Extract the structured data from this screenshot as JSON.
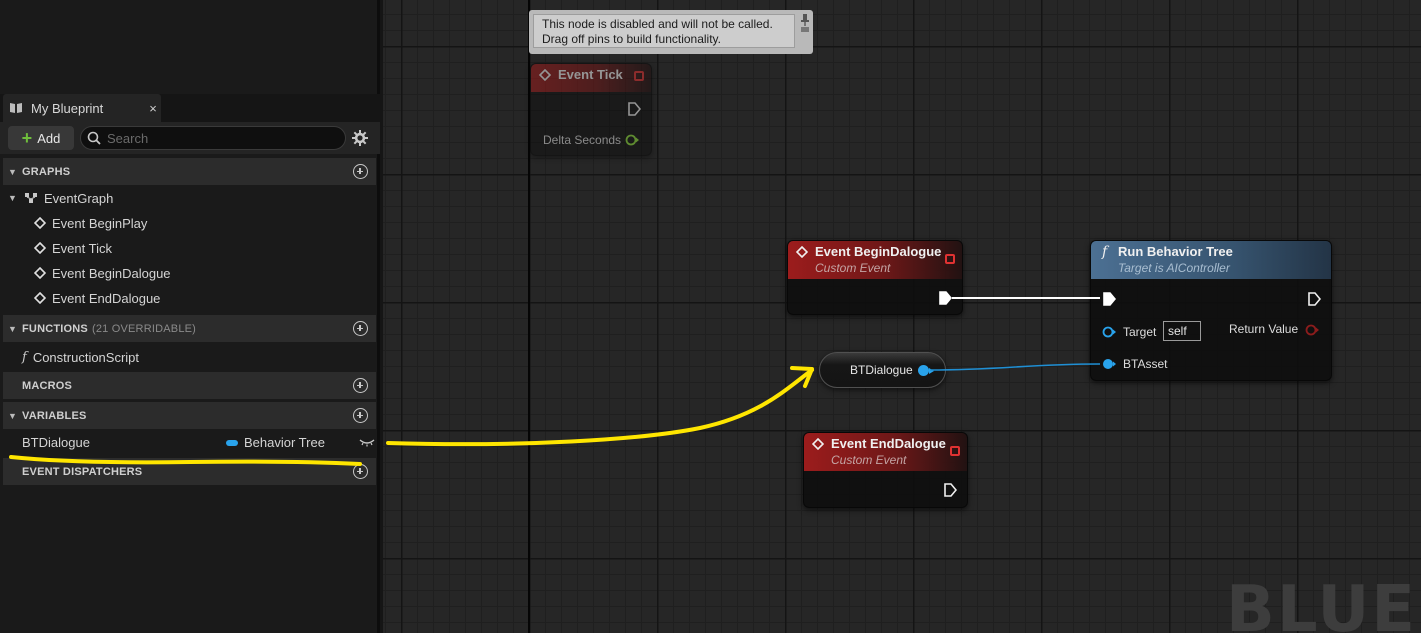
{
  "left_panel": {
    "tab": {
      "label": "My Blueprint",
      "close": "×"
    },
    "toolbar": {
      "add_label": "Add",
      "search_placeholder": "Search"
    },
    "sections": {
      "graphs": "GRAPHS",
      "functions": "FUNCTIONS",
      "functions_note": "(21 OVERRIDABLE)",
      "macros": "MACROS",
      "variables": "VARIABLES",
      "event_dispatchers": "EVENT DISPATCHERS"
    },
    "graph_items": {
      "event_graph": "EventGraph",
      "events": [
        "Event BeginPlay",
        "Event Tick",
        "Event BeginDalogue",
        "Event EndDalogue"
      ]
    },
    "function_items": [
      "ConstructionScript"
    ],
    "variable": {
      "name": "BTDialogue",
      "type": "Behavior Tree",
      "type_color": "#29a3ec"
    }
  },
  "graph": {
    "tooltip": [
      "This node is disabled and will not be called.",
      "Drag off pins to build functionality."
    ],
    "nodes": {
      "event_tick": {
        "title": "Event Tick",
        "pin_delta": "Delta Seconds"
      },
      "begin_dalogue": {
        "title": "Event BeginDalogue",
        "subtitle": "Custom Event"
      },
      "end_dalogue": {
        "title": "Event EndDalogue",
        "subtitle": "Custom Event"
      },
      "run_bt": {
        "title": "Run Behavior Tree",
        "subtitle": "Target is AIController",
        "pin_target": "Target",
        "pin_target_value": "self",
        "pin_return": "Return Value",
        "pin_asset": "BTAsset"
      },
      "btdialogue_getter": {
        "label": "BTDialogue"
      }
    },
    "watermark": "BLUE",
    "colors": {
      "event_header": "#9c1c1c",
      "function_header": "#4c7093",
      "object_pin": "#29a3ec",
      "annotation": "#ffe600"
    }
  }
}
